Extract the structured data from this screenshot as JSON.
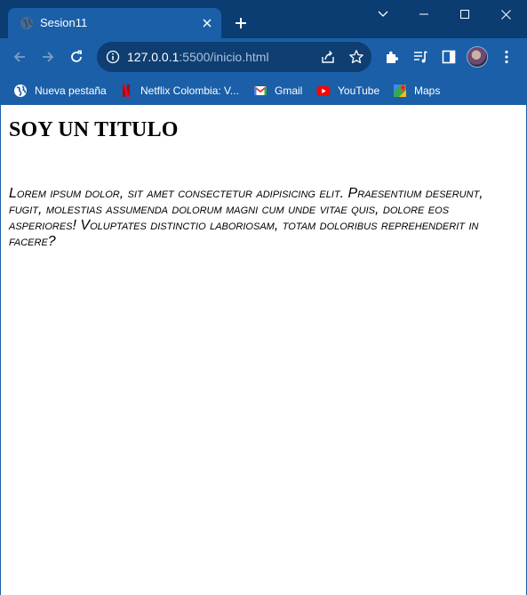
{
  "browser": {
    "tab": {
      "title": "Sesion11",
      "favicon": "globe-icon"
    },
    "address_bar": {
      "host": "127.0.0.1",
      "path": ":5500/inicio.html"
    },
    "bookmarks": [
      {
        "label": "Nueva pestaña",
        "icon": "globe-icon"
      },
      {
        "label": "Netflix Colombia: V...",
        "icon": "netflix-icon"
      },
      {
        "label": "Gmail",
        "icon": "gmail-icon"
      },
      {
        "label": "YouTube",
        "icon": "youtube-icon"
      },
      {
        "label": "Maps",
        "icon": "maps-icon"
      }
    ],
    "colors": {
      "frame": "#0b3d73",
      "toolbar": "#1a5fa8",
      "omnibox": "#0e3e72"
    }
  },
  "page": {
    "title": "SOY UN TITULO",
    "paragraph": "Lorem ipsum dolor, sit amet consectetur adipisicing elit. Praesentium deserunt, fugit, molestias assumenda dolorum magni cum unde vitae quis, dolore eos asperiores! Voluptates distinctio laboriosam, totam doloribus reprehenderit in facere?"
  }
}
